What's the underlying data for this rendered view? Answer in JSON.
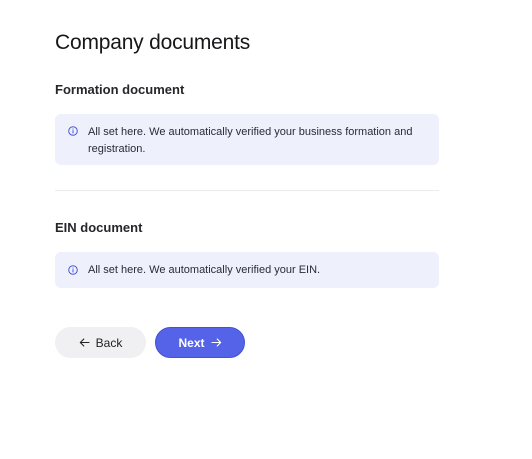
{
  "page": {
    "title": "Company documents"
  },
  "sections": {
    "formation": {
      "title": "Formation document",
      "notice": "All set here. We automatically verified your business formation and registration."
    },
    "ein": {
      "title": "EIN document",
      "notice": "All set here. We automatically verified your EIN."
    }
  },
  "footer": {
    "back_label": "Back",
    "next_label": "Next"
  },
  "icons": {
    "info": "info-circle-icon",
    "back": "arrow-left-icon",
    "next": "arrow-right-icon"
  },
  "colors": {
    "notice_background": "#eef0fb",
    "info_icon": "#4a57d6",
    "primary_button": "#5563e8",
    "secondary_button": "#f0f0f3"
  }
}
